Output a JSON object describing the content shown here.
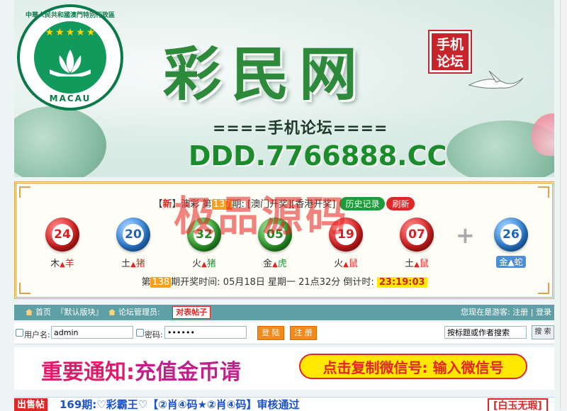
{
  "banner": {
    "emblem_ring_text": "中華人民共和國澳門特別行政區",
    "emblem_bottom_text": "MACAU",
    "emblem_stars": "★★★★★",
    "site_title": "彩民网",
    "seal_text": "手机论坛",
    "subtitle": "====手机论坛====",
    "domain": "DDD.7766888.CC"
  },
  "lottery": {
    "header_prefix": "【",
    "header_new": "新",
    "header_game": "】澳彩 第",
    "header_period": "137",
    "header_mid": "期: [澳门开奖]",
    "header_suffix": "[香港开奖]",
    "btn_history": "历史记录",
    "btn_refresh": "刷新",
    "balls": [
      {
        "number": "24",
        "color": "red",
        "element": "木",
        "animal": "羊",
        "animal_color": "red"
      },
      {
        "number": "20",
        "color": "blue",
        "element": "土",
        "animal": "猪",
        "animal_color": "red"
      },
      {
        "number": "32",
        "color": "green",
        "element": "火",
        "animal": "猪",
        "animal_color": "green"
      },
      {
        "number": "05",
        "color": "green",
        "element": "金",
        "animal": "虎",
        "animal_color": "green"
      },
      {
        "number": "19",
        "color": "red",
        "element": "火",
        "animal": "鼠",
        "animal_color": "red"
      },
      {
        "number": "07",
        "color": "red",
        "element": "土",
        "animal": "鼠",
        "animal_color": "red"
      }
    ],
    "plus": "+",
    "special": {
      "number": "26",
      "color": "blue",
      "zodiac": "金▲蛇"
    },
    "draw_prefix": "第",
    "draw_period": "138",
    "draw_text": "期开奖时间: 05月18日 星期一 21点32分   倒计时:",
    "countdown": "23:19:03",
    "watermark": "极品源码"
  },
  "nav": {
    "home": "首页",
    "default_board": "『默认版块』",
    "forum_admin": "论坛管理员:",
    "hot_post": "对表帖子",
    "status": "您现在是游客: 注册 | 登录"
  },
  "login": {
    "username_label": "用户名:",
    "username_value": "admin",
    "password_label": "密码:",
    "password_value": "••••••",
    "login_btn": "登 陆",
    "register_btn": "注 册",
    "search_placeholder": "按标题或作者搜索",
    "search_btn": "搜 索"
  },
  "notice": {
    "text_a": "重要通知:",
    "text_b": "充值金币请",
    "copy_btn": "点击复制微信号: 输入微信号"
  },
  "post": {
    "tag": "出售帖",
    "title": "169期:♡彩霸王♡【②肖④码★②肖④码】审核通过",
    "badge": "[白玉无瑕]"
  }
}
